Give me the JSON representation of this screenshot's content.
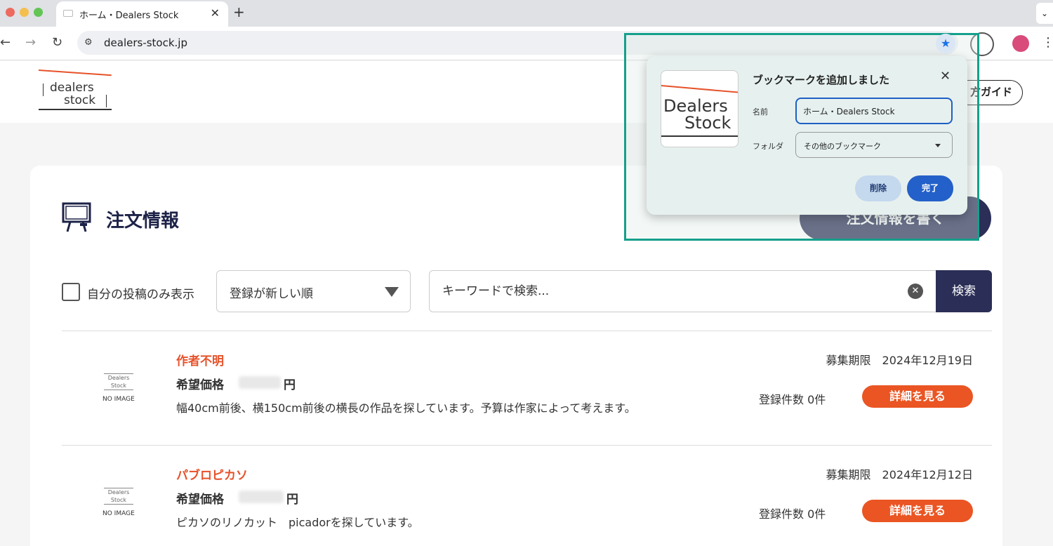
{
  "browser": {
    "tab_title": "ホーム・Dealers Stock",
    "tab_close": "✕",
    "new_tab": "+",
    "url": "dealers-stock.jp"
  },
  "header": {
    "logo_line1": "dealers",
    "logo_line2": "stock",
    "guide_button": "方ガイド"
  },
  "main": {
    "title": "注文情報",
    "write_button": "注文情報を書く",
    "filter_label": "自分の投稿のみ表示",
    "sort_value": "登録が新しい順",
    "search_placeholder": "キーワードで検索...",
    "search_button": "検索"
  },
  "orders": [
    {
      "artist": "作者不明",
      "price_label": "希望価格",
      "price_unit": "円",
      "description": "幅40cm前後、横150cm前後の横長の作品を探しています。予算は作家によって考えます。",
      "deadline": "募集期限　2024年12月19日",
      "count": "登録件数 0件",
      "detail_button": "詳細を見る",
      "noimage_logo": "Dealers Stock",
      "noimage_text": "NO IMAGE"
    },
    {
      "artist": "パブロピカソ",
      "price_label": "希望価格",
      "price_unit": "円",
      "description": "ピカソのリノカット　picadorを探しています。",
      "deadline": "募集期限　2024年12月12日",
      "count": "登録件数 0件",
      "detail_button": "詳細を見る",
      "noimage_logo": "Dealers Stock",
      "noimage_text": "NO IMAGE"
    }
  ],
  "bookmark_popup": {
    "title": "ブックマークを追加しました",
    "thumb_line1": "Dealers",
    "thumb_line2": "Stock",
    "name_label": "名前",
    "name_value": "ホーム・Dealers Stock",
    "folder_label": "フォルダ",
    "folder_value": "その他のブックマーク",
    "delete_button": "削除",
    "done_button": "完了",
    "close": "✕"
  },
  "colors": {
    "accent_orange": "#ea5523",
    "navy": "#2b2f57",
    "highlight": "#14a08c",
    "popup_blue": "#2460c9"
  }
}
